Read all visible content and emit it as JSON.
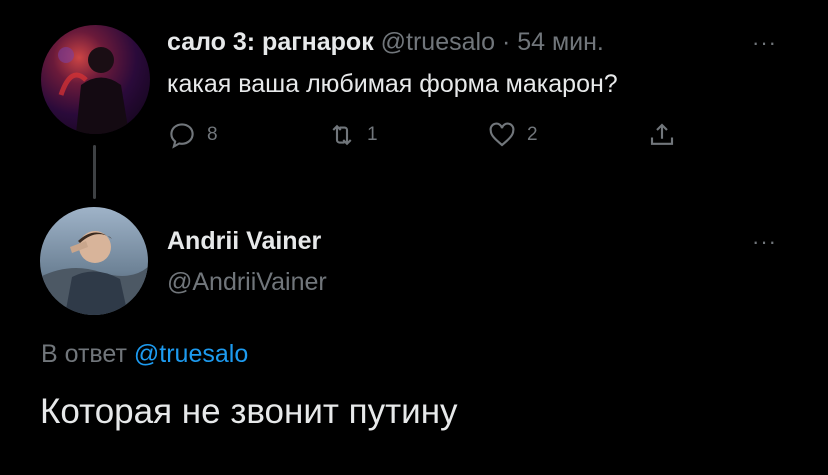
{
  "tweet1": {
    "display_name": "сало 3: рагнарок",
    "handle": "@truesalo",
    "separator": "·",
    "time": "54 мин.",
    "text": "какая ваша любимая форма макарон?",
    "more_label": "···",
    "replies": "8",
    "retweets": "1",
    "likes": "2"
  },
  "tweet2": {
    "display_name": "Andrii Vainer",
    "handle": "@AndriiVainer",
    "more_label": "···",
    "reply_prefix": "В ответ",
    "reply_handle": "@truesalo",
    "text": "Которая не звонит путину"
  },
  "icons": {
    "reply": "reply-icon",
    "retweet": "retweet-icon",
    "like": "heart-icon",
    "share": "share-icon"
  },
  "colors": {
    "background": "#000000",
    "text": "#e7e9ea",
    "muted": "#71767b",
    "link": "#1d9bf0"
  }
}
